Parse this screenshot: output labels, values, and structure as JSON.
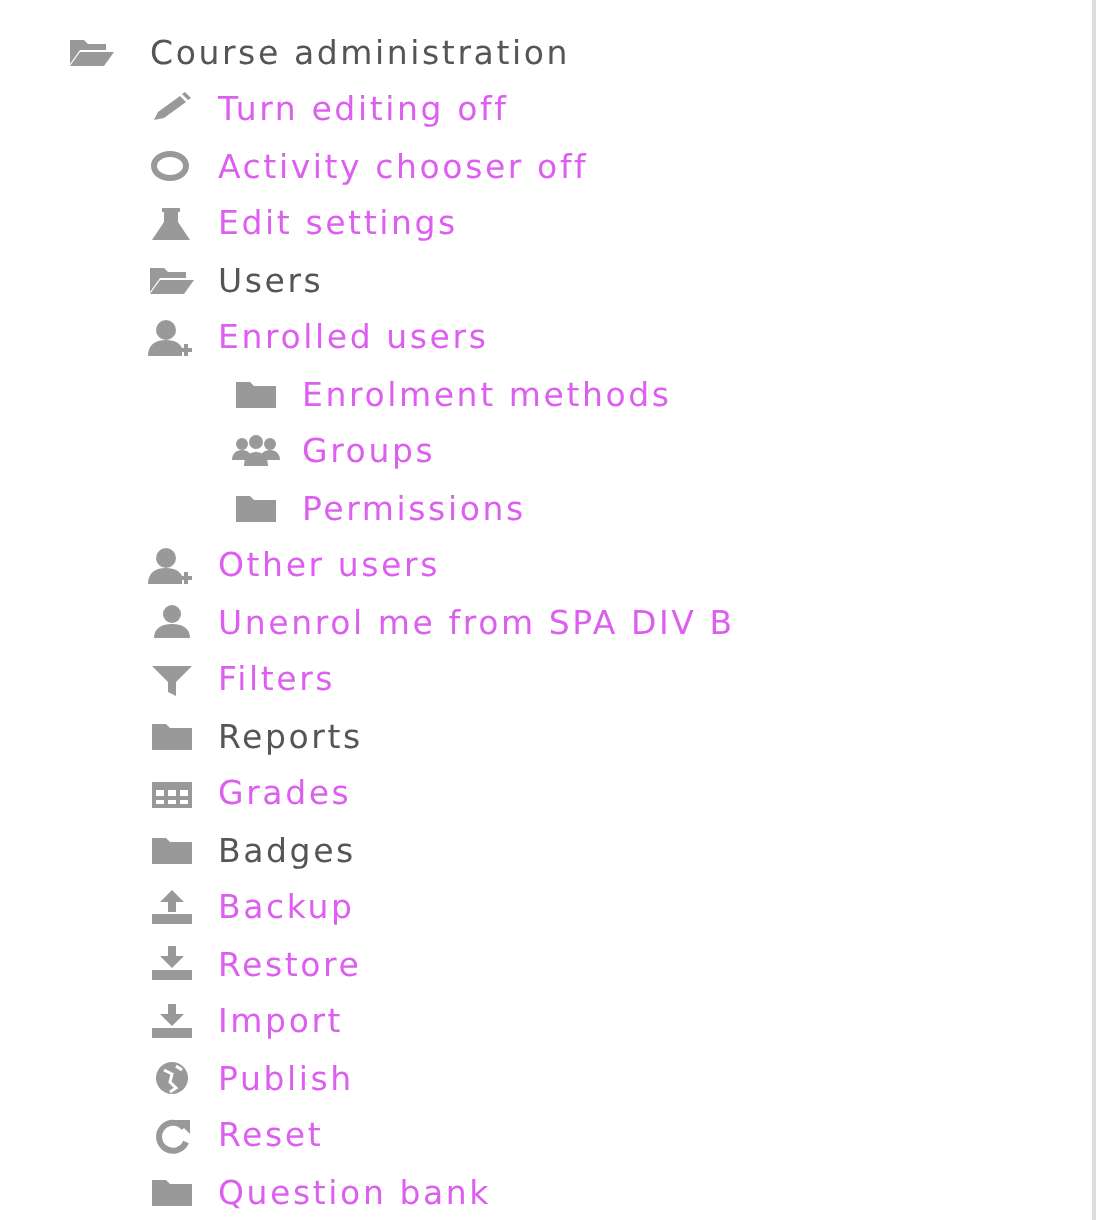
{
  "tree": {
    "label": "Course administration",
    "kind": "branch",
    "children": [
      {
        "label": "Turn editing off",
        "kind": "link"
      },
      {
        "label": "Activity chooser off",
        "kind": "link"
      },
      {
        "label": "Edit settings",
        "kind": "link"
      },
      {
        "label": "Users",
        "kind": "branch"
      },
      {
        "label": "Enrolled users",
        "kind": "link",
        "children": [
          {
            "label": "Enrolment methods",
            "kind": "link"
          },
          {
            "label": "Groups",
            "kind": "link"
          },
          {
            "label": "Permissions",
            "kind": "link"
          }
        ]
      },
      {
        "label": "Other users",
        "kind": "link"
      },
      {
        "label": "Unenrol me from SPA DIV B",
        "kind": "link"
      },
      {
        "label": "Filters",
        "kind": "link"
      },
      {
        "label": "Reports",
        "kind": "branch"
      },
      {
        "label": "Grades",
        "kind": "link"
      },
      {
        "label": "Badges",
        "kind": "branch"
      },
      {
        "label": "Backup",
        "kind": "link"
      },
      {
        "label": "Restore",
        "kind": "link"
      },
      {
        "label": "Import",
        "kind": "link"
      },
      {
        "label": "Publish",
        "kind": "link"
      },
      {
        "label": "Reset",
        "kind": "link"
      },
      {
        "label": "Question bank",
        "kind": "link"
      }
    ]
  }
}
